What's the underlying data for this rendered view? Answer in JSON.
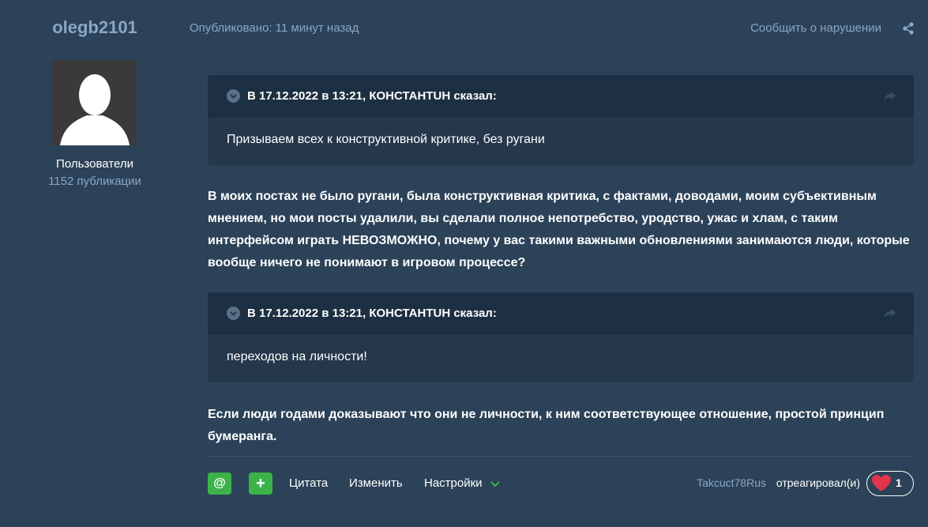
{
  "author": {
    "username": "olegb2101",
    "group": "Пользователи",
    "posts_count": "1152 публикации"
  },
  "post": {
    "published": "Опубликовано: 11 минут назад",
    "report": "Сообщить о нарушении",
    "quotes": [
      {
        "cite": "В 17.12.2022 в 13:21, КОНСТАНТUН сказал:",
        "text": "Призываем всех к конструктивной критике, без ругани"
      },
      {
        "cite": "В 17.12.2022 в 13:21, КОНСТАНТUН сказал:",
        "text": "переходов на личности!"
      }
    ],
    "paragraphs": [
      "В моих постах не было ругани, была конструктивная критика, с фактами, доводами, моим субъективным мнением, но мои посты удалили, вы сделали полное непотребство, уродство, ужас и хлам, с таким интерфейсом играть НЕВОЗМОЖНО, почему у вас такими важными обновлениями занимаются люди, которые вообще ничего не понимают в игровом процессе?",
      "Если люди годами доказывают что они не личности, к ним соответствующее отношение, простой принцип бумеранга."
    ]
  },
  "footer": {
    "mention_label": "@",
    "multiquote_label": "+",
    "quote_label": "Цитата",
    "edit_label": "Изменить",
    "options_label": "Настройки",
    "reaction_user": "Takcuct78Rus",
    "reaction_text": "отреагировал(и)",
    "reaction_count": "1"
  },
  "colors": {
    "background": "#2c4258",
    "accent_green": "#3cb34a",
    "muted_blue": "#8aa6c6",
    "heart": "#e0354a"
  },
  "icons": [
    "share-icon",
    "chevron-down-icon",
    "reply-arrow-icon",
    "heart-icon"
  ]
}
